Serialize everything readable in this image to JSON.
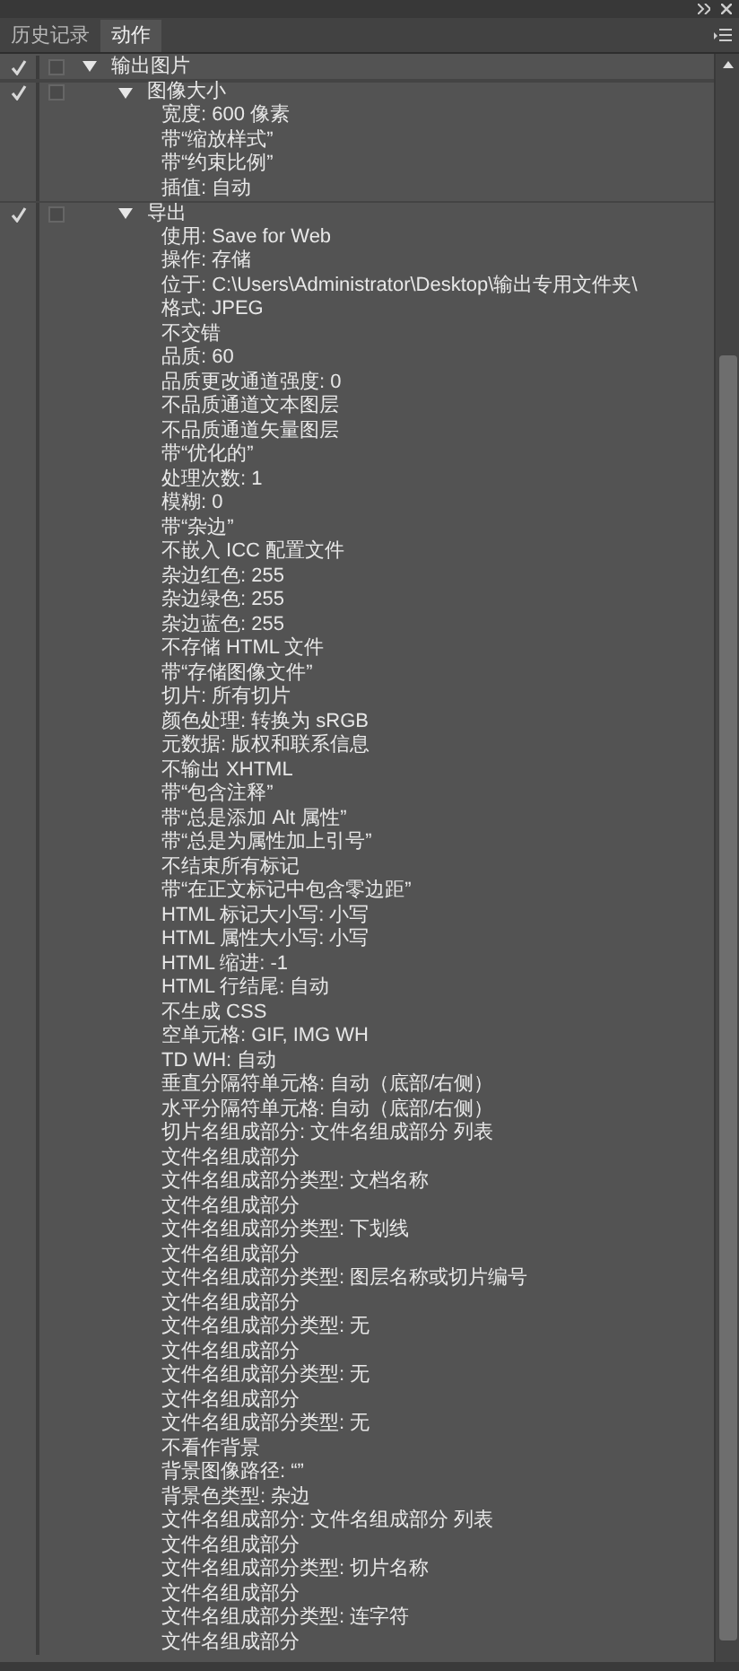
{
  "panel": {
    "tabs": [
      {
        "label": "历史记录",
        "selected": false
      },
      {
        "label": "动作",
        "selected": true
      }
    ],
    "actions": [
      {
        "name": "输出图片",
        "enabled": true,
        "expanded": true,
        "children": [
          {
            "name": "图像大小",
            "enabled": true,
            "expanded": true,
            "children": [
              "宽度: 600 像素",
              "带“缩放样式”",
              "带“约束比例”",
              "插值: 自动"
            ]
          },
          {
            "name": "导出",
            "enabled": true,
            "expanded": true,
            "children": [
              "使用: Save for Web",
              "操作: 存储",
              "位于: C:\\Users\\Administrator\\Desktop\\输出专用文件夹\\",
              "格式: JPEG",
              "不交错",
              "品质: 60",
              "品质更改通道强度: 0",
              "不品质通道文本图层",
              "不品质通道矢量图层",
              "带“优化的”",
              "处理次数: 1",
              "模糊: 0",
              "带“杂边”",
              "不嵌入 ICC 配置文件",
              "杂边红色: 255",
              "杂边绿色: 255",
              "杂边蓝色: 255",
              "不存储 HTML 文件",
              "带“存储图像文件”",
              "切片: 所有切片",
              "颜色处理: 转换为 sRGB",
              "元数据: 版权和联系信息",
              "不输出 XHTML",
              "带“包含注释”",
              "带“总是添加 Alt 属性”",
              "带“总是为属性加上引号”",
              "不结束所有标记",
              "带“在正文标记中包含零边距”",
              "HTML 标记大小写: 小写",
              "HTML 属性大小写: 小写",
              "HTML 缩进: -1",
              "HTML 行结尾: 自动",
              "不生成 CSS",
              "空单元格: GIF, IMG WH",
              "TD WH: 自动",
              "垂直分隔符单元格: 自动（底部/右侧）",
              "水平分隔符单元格: 自动（底部/右侧）",
              "切片名组成部分: 文件名组成部分 列表",
              "文件名组成部分",
              "文件名组成部分类型: 文档名称",
              "文件名组成部分",
              "文件名组成部分类型: 下划线",
              "文件名组成部分",
              "文件名组成部分类型: 图层名称或切片编号",
              "文件名组成部分",
              "文件名组成部分类型: 无",
              "文件名组成部分",
              "文件名组成部分类型: 无",
              "文件名组成部分",
              "文件名组成部分类型: 无",
              "不看作背景",
              "背景图像路径: “”",
              "背景色类型: 杂边",
              "文件名组成部分: 文件名组成部分 列表",
              "文件名组成部分",
              "文件名组成部分类型: 切片名称",
              "文件名组成部分",
              "文件名组成部分类型: 连字符",
              "文件名组成部分"
            ]
          }
        ]
      }
    ]
  }
}
